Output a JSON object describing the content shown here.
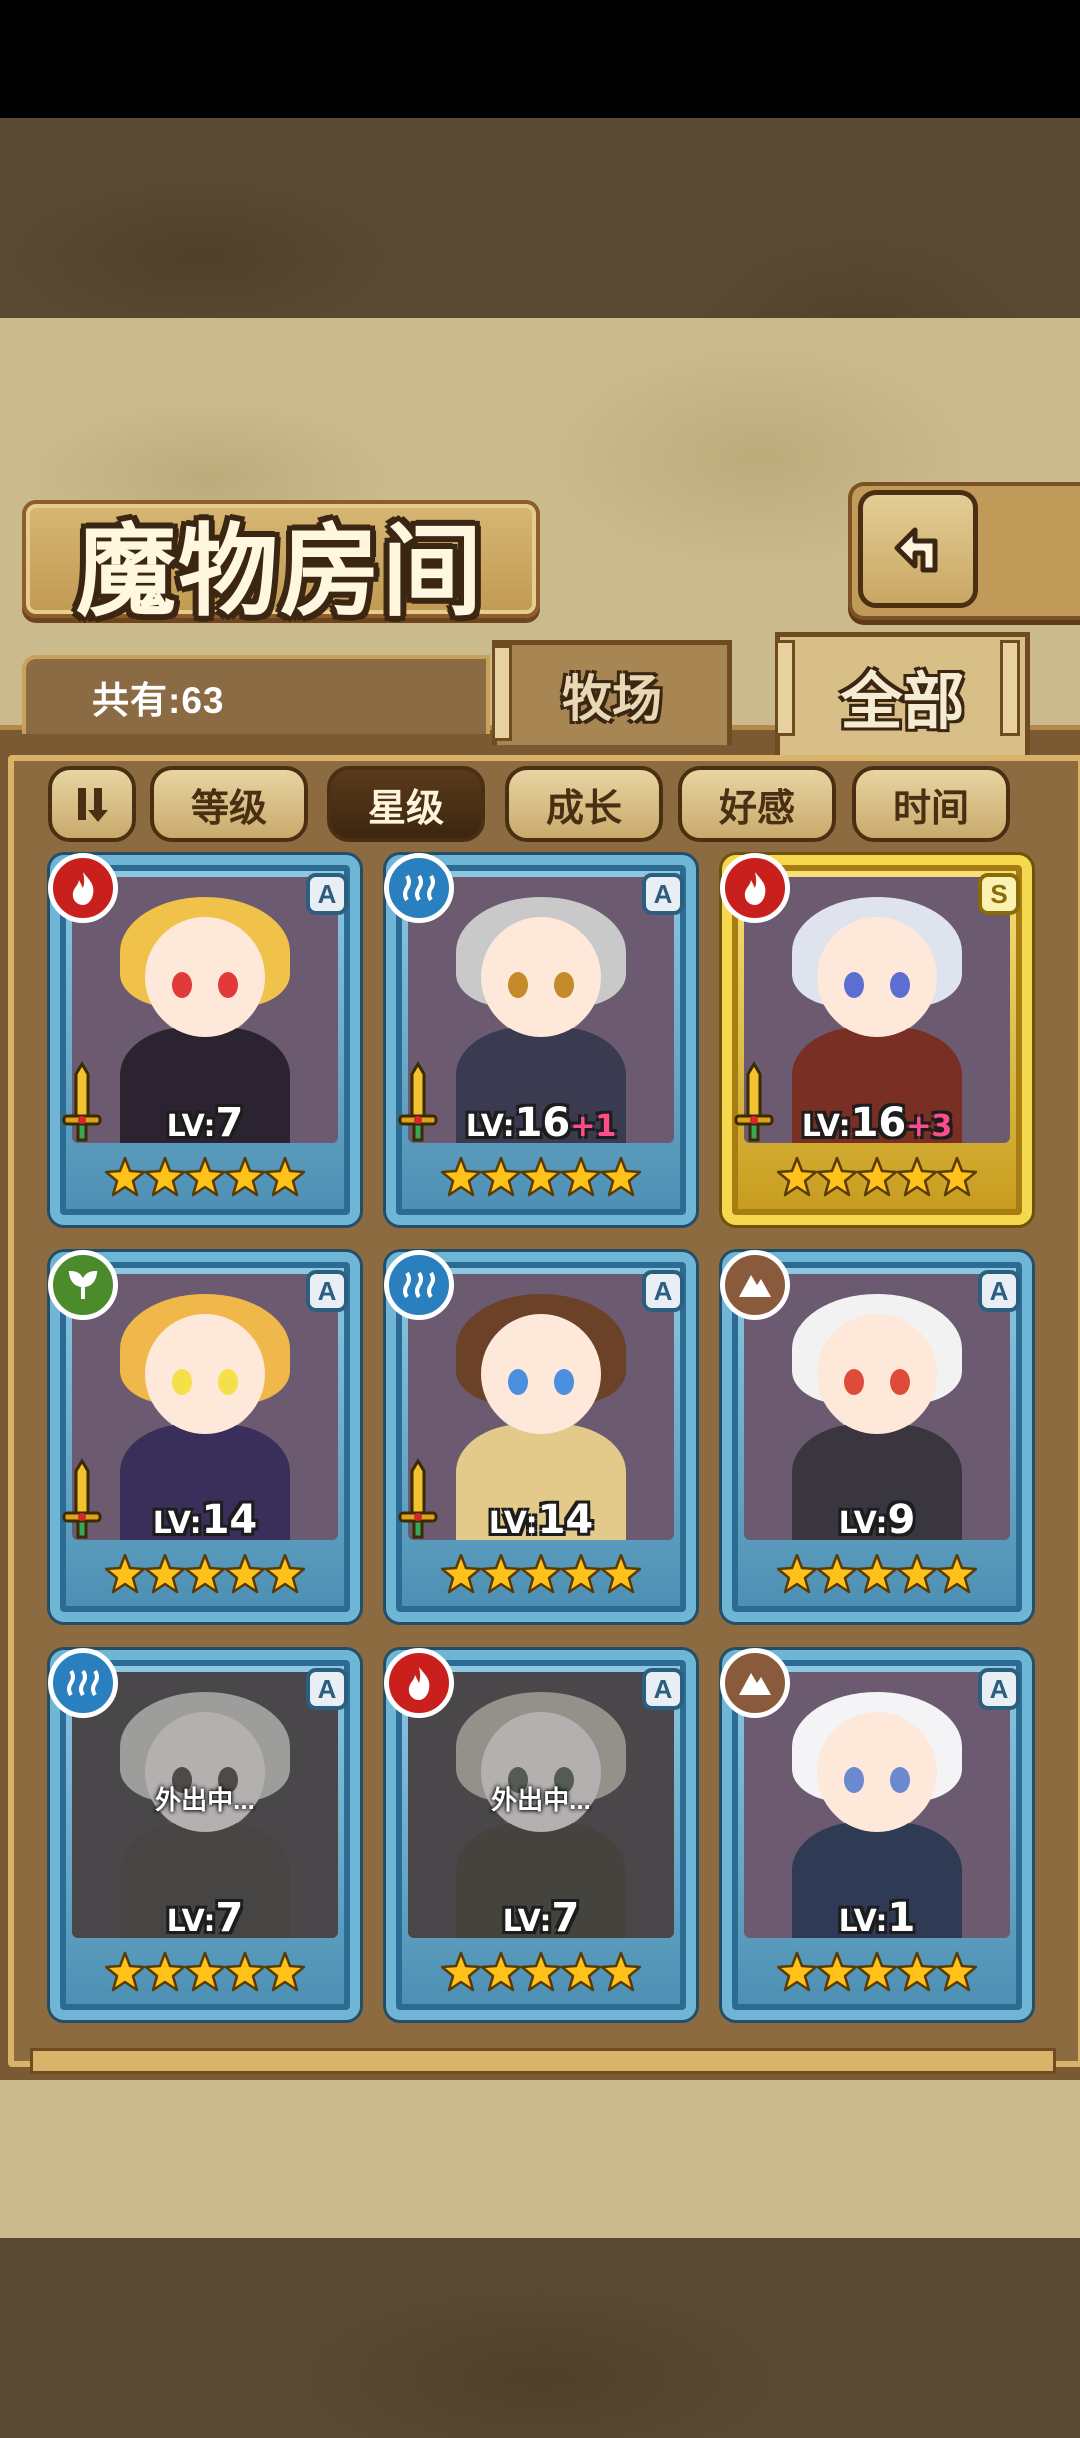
{
  "title": "魔物房间",
  "count_label": "共有:63",
  "tabs": [
    {
      "label": "牧场",
      "active": false
    },
    {
      "label": "全部",
      "active": true
    }
  ],
  "sort_buttons": [
    {
      "label": "等级",
      "active": false
    },
    {
      "label": "星级",
      "active": true
    },
    {
      "label": "成长",
      "active": false
    },
    {
      "label": "好感",
      "active": false
    },
    {
      "label": "时间",
      "active": false
    }
  ],
  "colors": {
    "frame_blue": "#6fb6d6",
    "frame_gold": "#f5d84d",
    "fire": "#c9201d",
    "water": "#2a7fbf",
    "wood": "#4c8b2b",
    "earth": "#8a5a3c",
    "star": "#ffc21a"
  },
  "monsters": [
    {
      "element": "fire",
      "rank": "A",
      "lv_prefix": "LV:",
      "level": "7",
      "plus": "",
      "stars": 5,
      "sword": true,
      "frame": "blue",
      "away": false,
      "hair": "#f1c24a",
      "body": "#2b2430",
      "eyes": "#e23a3a"
    },
    {
      "element": "water",
      "rank": "A",
      "lv_prefix": "LV:",
      "level": "16",
      "plus": "+1",
      "stars": 5,
      "sword": true,
      "frame": "blue",
      "away": false,
      "hair": "#c9c9c9",
      "body": "#3a3a50",
      "eyes": "#c58a2a"
    },
    {
      "element": "fire",
      "rank": "S",
      "lv_prefix": "LV:",
      "level": "16",
      "plus": "+3",
      "stars": 5,
      "sword": true,
      "frame": "gold",
      "away": false,
      "hair": "#dfe3ee",
      "body": "#7a2f25",
      "eyes": "#5a6fd0"
    },
    {
      "element": "wood",
      "rank": "A",
      "lv_prefix": "LV:",
      "level": "14",
      "plus": "",
      "stars": 5,
      "sword": true,
      "frame": "blue",
      "away": false,
      "hair": "#f0b84a",
      "body": "#3a2f5a",
      "eyes": "#f5e04a"
    },
    {
      "element": "water",
      "rank": "A",
      "lv_prefix": "LV:",
      "level": "14",
      "plus": "",
      "stars": 5,
      "sword": true,
      "frame": "blue",
      "away": false,
      "hair": "#6b4128",
      "body": "#e3c98a",
      "eyes": "#4a8fe0"
    },
    {
      "element": "earth",
      "rank": "A",
      "lv_prefix": "LV:",
      "level": "9",
      "plus": "",
      "stars": 5,
      "sword": false,
      "frame": "blue",
      "away": false,
      "hair": "#f2f2f2",
      "body": "#3a3640",
      "eyes": "#e04a3a"
    },
    {
      "element": "water",
      "rank": "A",
      "lv_prefix": "LV:",
      "level": "7",
      "plus": "",
      "stars": 5,
      "sword": false,
      "frame": "blue",
      "away": true,
      "away_text": "外出中...",
      "hair": "#d8d0c4",
      "body": "#6a5a4a",
      "eyes": "#8a5a4a"
    },
    {
      "element": "fire",
      "rank": "A",
      "lv_prefix": "LV:",
      "level": "7",
      "plus": "",
      "stars": 5,
      "sword": false,
      "frame": "blue",
      "away": true,
      "away_text": "外出中...",
      "hair": "#d9c08a",
      "body": "#6a5a2a",
      "eyes": "#4a8a3a"
    },
    {
      "element": "earth",
      "rank": "A",
      "lv_prefix": "LV:",
      "level": "1",
      "plus": "",
      "stars": 5,
      "sword": false,
      "frame": "blue",
      "away": false,
      "hair": "#f4f4f6",
      "body": "#2f3a55",
      "eyes": "#6a8ad0"
    }
  ]
}
